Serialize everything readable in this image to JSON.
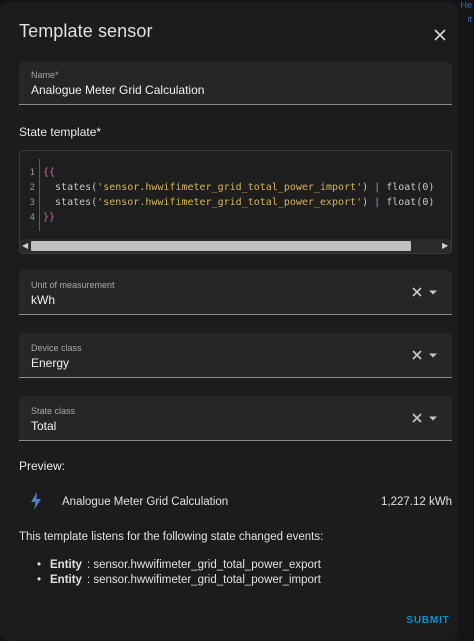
{
  "dialog": {
    "title": "Template sensor",
    "close_icon": "close-icon"
  },
  "name_field": {
    "label": "Name*",
    "value": "Analogue Meter Grid Calculation"
  },
  "state_template": {
    "label": "State template*",
    "line_numbers": [
      "1",
      "2",
      "3",
      "4"
    ],
    "lines": [
      [
        {
          "t": "{{",
          "c": "brace"
        }
      ],
      [
        {
          "t": "  states(",
          "c": "fn"
        },
        {
          "t": "'sensor.hwwifimeter_grid_total_power_import'",
          "c": "str"
        },
        {
          "t": ") ",
          "c": "fn"
        },
        {
          "t": "|",
          "c": "op"
        },
        {
          "t": " float(0)",
          "c": "fn"
        }
      ],
      [
        {
          "t": "  states(",
          "c": "fn"
        },
        {
          "t": "'sensor.hwwifimeter_grid_total_power_export'",
          "c": "str"
        },
        {
          "t": ") ",
          "c": "fn"
        },
        {
          "t": "|",
          "c": "op"
        },
        {
          "t": " float(0)",
          "c": "fn"
        }
      ],
      [
        {
          "t": "}}",
          "c": "brace"
        }
      ]
    ],
    "scroll_left_icon": "triangle-left-icon",
    "scroll_right_icon": "triangle-right-icon"
  },
  "unit_field": {
    "label": "Unit of measurement",
    "value": "kWh"
  },
  "device_class_field": {
    "label": "Device class",
    "value": "Energy"
  },
  "state_class_field": {
    "label": "State class",
    "value": "Total"
  },
  "preview": {
    "label": "Preview:",
    "icon": "lightning-bolt-icon",
    "entity_name": "Analogue Meter Grid Calculation",
    "entity_value": "1,227.12 kWh"
  },
  "listens": {
    "text": "This template listens for the following state changed events:",
    "items": [
      {
        "bullet": "•",
        "key": "Entity",
        "id": ": sensor.hwwifimeter_grid_total_power_export"
      },
      {
        "bullet": "•",
        "key": "Entity",
        "id": ": sensor.hwwifimeter_grid_total_power_import"
      }
    ]
  },
  "actions": {
    "submit_label": "SUBMIT"
  },
  "background_peek": [
    "He",
    "it"
  ],
  "colors": {
    "accent": "#0a8fd8",
    "dialog_bg": "#1c1c1c",
    "field_bg": "#262626",
    "lightning_icon": "#4a7fc0"
  }
}
